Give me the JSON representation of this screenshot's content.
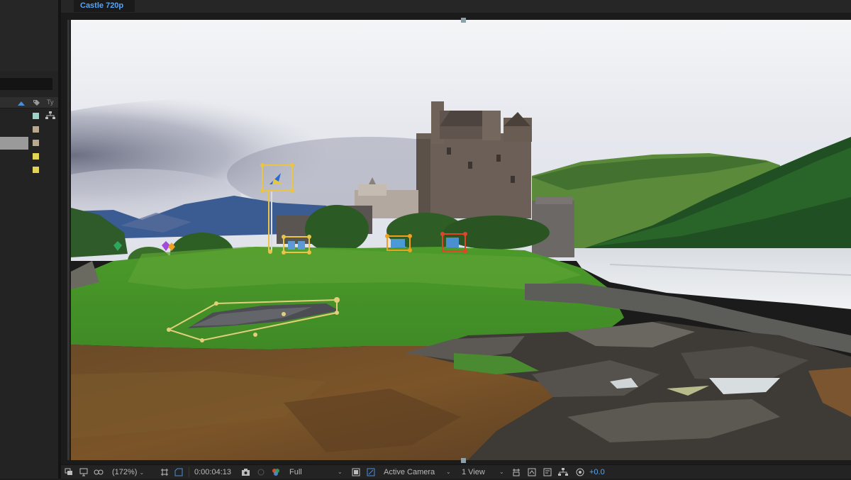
{
  "composition": {
    "tab_name": "Castle 720p"
  },
  "project_panel": {
    "type_column_label": "Ty",
    "label_colors": [
      "#9fd1c9",
      "#b7a88f",
      "#b7a88f",
      "#e2d455",
      "#e2d455"
    ],
    "sort_accent": "#4c8fd8"
  },
  "tracker_colors": {
    "yellow": "#e8c447",
    "orange": "#f0a020",
    "red": "#e0452a",
    "purple": "#a24bd8",
    "green": "#2fa65a",
    "plane": "#e3cf7a"
  },
  "viewer_toolbar": {
    "magnification": "(172%)",
    "timecode": "0:00:04:13",
    "resolution": "Full",
    "camera": "Active Camera",
    "views": "1 View",
    "exposure": "+0.0",
    "icons": [
      "always-preview-icon",
      "monitor-icon",
      "mask-visibility-icon",
      "region-of-interest-icon",
      "transparency-grid-icon",
      "snapshot-camera-icon",
      "show-snapshot-icon",
      "color-channels-icon",
      "fast-previews-icon",
      "toggle-transparency-icon",
      "3d-view-icon",
      "pixel-aspect-icon",
      "timeline-icon",
      "flowchart-icon",
      "reset-exposure-icon"
    ]
  }
}
